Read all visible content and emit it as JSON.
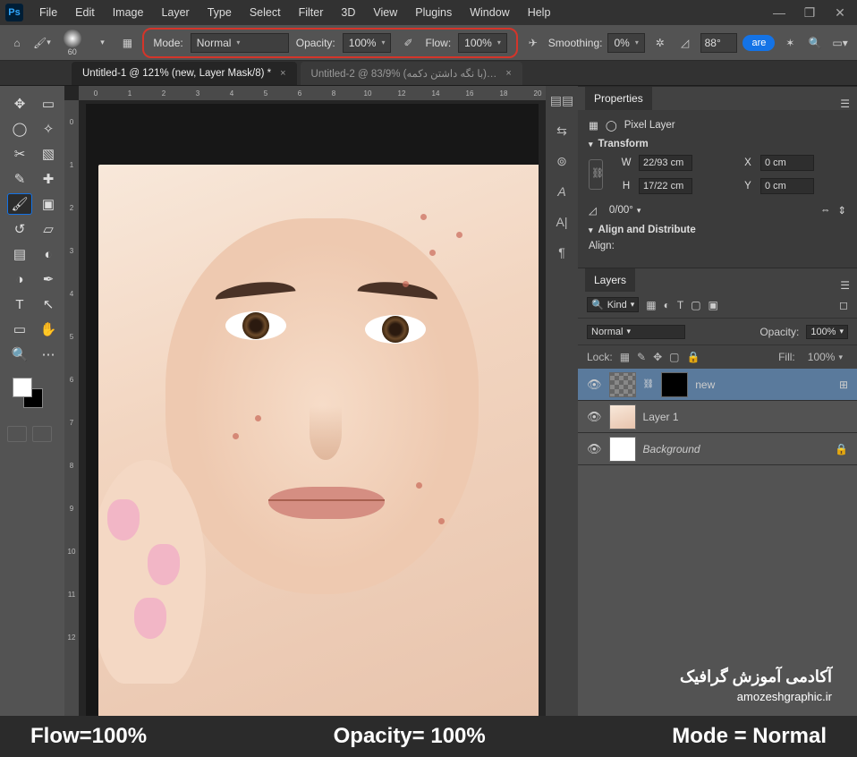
{
  "menu": {
    "items": [
      "File",
      "Edit",
      "Image",
      "Layer",
      "Type",
      "Select",
      "Filter",
      "3D",
      "View",
      "Plugins",
      "Window",
      "Help"
    ]
  },
  "window": {
    "minimize": "—",
    "restore": "❐",
    "close": "✕"
  },
  "options": {
    "home": "⌂",
    "brush": "✦",
    "brush_size": "60",
    "dropdown": "▾",
    "blend_panel": "▦",
    "mode_label": "Mode:",
    "mode_value": "Normal",
    "opacity_label": "Opacity:",
    "opacity_value": "100%",
    "pressure_icon": "✐",
    "flow_label": "Flow:",
    "flow_value": "100%",
    "airbrush_icon": "✈",
    "smoothing_label": "Smoothing:",
    "smoothing_value": "0%",
    "gear": "✲",
    "angle_icon": "◿",
    "angle_value": "88°",
    "share": "are",
    "square": "▢",
    "drop_gear": "⚙"
  },
  "tabs": [
    {
      "label": "Untitled-1 @ 121% (new, Layer Mask/8) *",
      "active": true
    },
    {
      "label": "Untitled-2 @ 83/9% (با نگه داشتن دکمه)…",
      "active": false
    }
  ],
  "ruler_h": [
    "0",
    "1",
    "2",
    "3",
    "4",
    "5",
    "6",
    "8",
    "10",
    "12",
    "14",
    "16",
    "18",
    "20"
  ],
  "ruler_v": [
    "0",
    "1",
    "2",
    "3",
    "4",
    "5",
    "6",
    "7",
    "8",
    "9",
    "10",
    "11",
    "12"
  ],
  "tools": {
    "move": "✥",
    "marquee": "▭",
    "lasso": "◯",
    "wand": "✧",
    "crop": "✂",
    "frame": "▧",
    "eyedrop": "✎",
    "heal": "✚",
    "brush": "🖌",
    "stamp": "▣",
    "history": "↺",
    "eraser": "▱",
    "gradient": "▤",
    "blur": "◐",
    "dodge": "◑",
    "pen": "✒",
    "type": "T",
    "path": "↖",
    "shape": "▭",
    "hand": "✋",
    "zoom": "🔍",
    "threedot": "⋯"
  },
  "right_strip": {
    "items": [
      "▤▤",
      "⇆",
      "⊚",
      "A",
      "A|",
      "¶"
    ]
  },
  "properties": {
    "title": "Properties",
    "kind_icons": [
      "▦",
      "◯"
    ],
    "kind": "Pixel Layer",
    "transform_hd": "Transform",
    "w_lab": "W",
    "w": "22/93 cm",
    "x_lab": "X",
    "x": "0 cm",
    "h_lab": "H",
    "h": "17/22 cm",
    "y_lab": "Y",
    "y": "0 cm",
    "rot_lab": "◿",
    "rot": "0/00°",
    "flip_h": "⇔",
    "flip_v": "⇕",
    "align_hd": "Align and Distribute",
    "align_lab": "Align:"
  },
  "layers": {
    "title": "Layers",
    "kind_label": "Kind",
    "kind_icons": [
      "▦",
      "◐",
      "T",
      "▢",
      "▣",
      "◻"
    ],
    "blend": "Normal",
    "opacity_label": "Opacity:",
    "opacity": "100%",
    "lock_label": "Lock:",
    "lock_icons": [
      "▦",
      "✎",
      "✥",
      "▢",
      "🔒"
    ],
    "fill_label": "Fill:",
    "fill": "100%",
    "items": [
      {
        "vis": "👁",
        "type": "mask",
        "name": "new",
        "sel": true,
        "smart": true
      },
      {
        "vis": "👁",
        "type": "img",
        "name": "Layer 1",
        "sel": false
      },
      {
        "vis": "👁",
        "type": "white",
        "name": "Background",
        "sel": false,
        "locked": true
      }
    ]
  },
  "credits": {
    "line1": "آکادمی آموزش گرافیک",
    "line2": "amozeshgraphic.ir"
  },
  "overlay": {
    "flow": "Flow=100%",
    "opacity": "Opacity= 100%",
    "mode": "Mode = Normal"
  }
}
